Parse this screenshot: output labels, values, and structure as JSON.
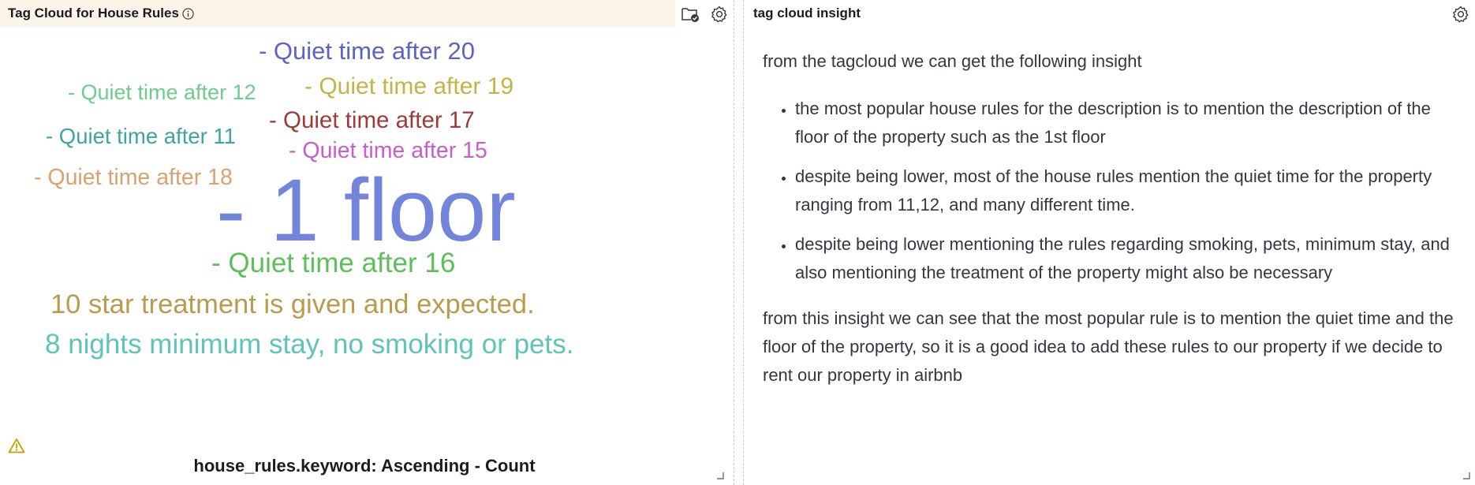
{
  "left_panel": {
    "title": "Tag Cloud for House Rules",
    "axis_caption": "house_rules.keyword: Ascending - Count",
    "icons": [
      "info-icon",
      "folder-check-icon",
      "gear-icon",
      "warning-icon",
      "resize-handle-icon"
    ],
    "tags": [
      {
        "text": "- Quiet time after 20",
        "color": "#5b64c4"
      },
      {
        "text": "- Quiet time after 12",
        "color": "#6dcc8e"
      },
      {
        "text": "- Quiet time after 19",
        "color": "#c4b346"
      },
      {
        "text": "- Quiet time after 17",
        "color": "#9c3b37"
      },
      {
        "text": "- Quiet time after 11",
        "color": "#3fa3a3"
      },
      {
        "text": "- Quiet time after 15",
        "color": "#c65fc9"
      },
      {
        "text": "- Quiet time after 18",
        "color": "#d9a26e"
      },
      {
        "text": "- 1 floor",
        "color": "#7285db"
      },
      {
        "text": "- Quiet time after 16",
        "color": "#5cbf5a"
      },
      {
        "text": "10 star treatment is given and expected.",
        "color": "#bb9a4e"
      },
      {
        "text": "8 nights minimum stay, no smoking or pets.",
        "color": "#5ec4b8"
      }
    ]
  },
  "right_panel": {
    "title": "tag cloud insight",
    "intro": "from the tagcloud we can get the following insight",
    "bullets": [
      "the most popular house rules for the description is to mention the description of the floor of the property such as the 1st floor",
      "despite being lower, most of the house rules mention the quiet time for the property ranging from 11,12, and many different time.",
      "despite being lower mentioning the rules regarding smoking, pets, minimum stay, and also mentioning the treatment of the property might also be necessary"
    ],
    "conclusion": "from this insight we can see that the most popular rule is to mention the quiet time and the floor of the property, so it is a good idea to add these rules to our property if we decide to rent our property in airbnb"
  }
}
